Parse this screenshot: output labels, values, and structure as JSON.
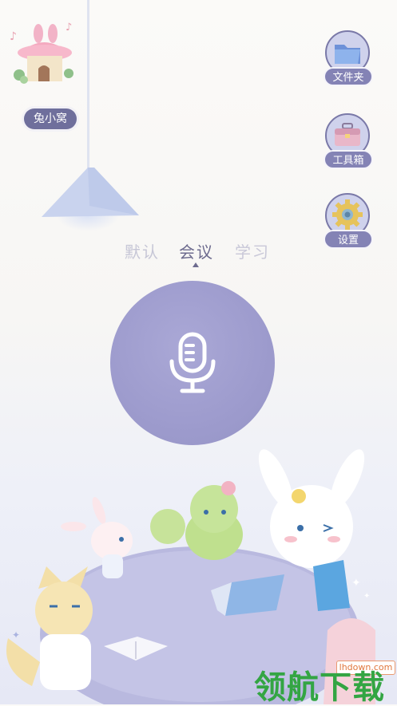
{
  "home": {
    "label": "兔小窝"
  },
  "side_buttons": [
    {
      "label": "文件夹",
      "icon": "folder-icon"
    },
    {
      "label": "工具箱",
      "icon": "toolbox-icon"
    },
    {
      "label": "设置",
      "icon": "gear-icon"
    }
  ],
  "modes": {
    "items": [
      "默认",
      "会议",
      "学习"
    ],
    "selected": "会议"
  },
  "mic": {
    "icon": "microphone-icon"
  },
  "watermark": {
    "url": "lhdown.com",
    "title": "领航下载"
  },
  "colors": {
    "accent": "#9d9bcd",
    "label_bg": "#8483b5",
    "home_label_bg": "#6f6f9c",
    "watermark_green": "#33a543"
  }
}
